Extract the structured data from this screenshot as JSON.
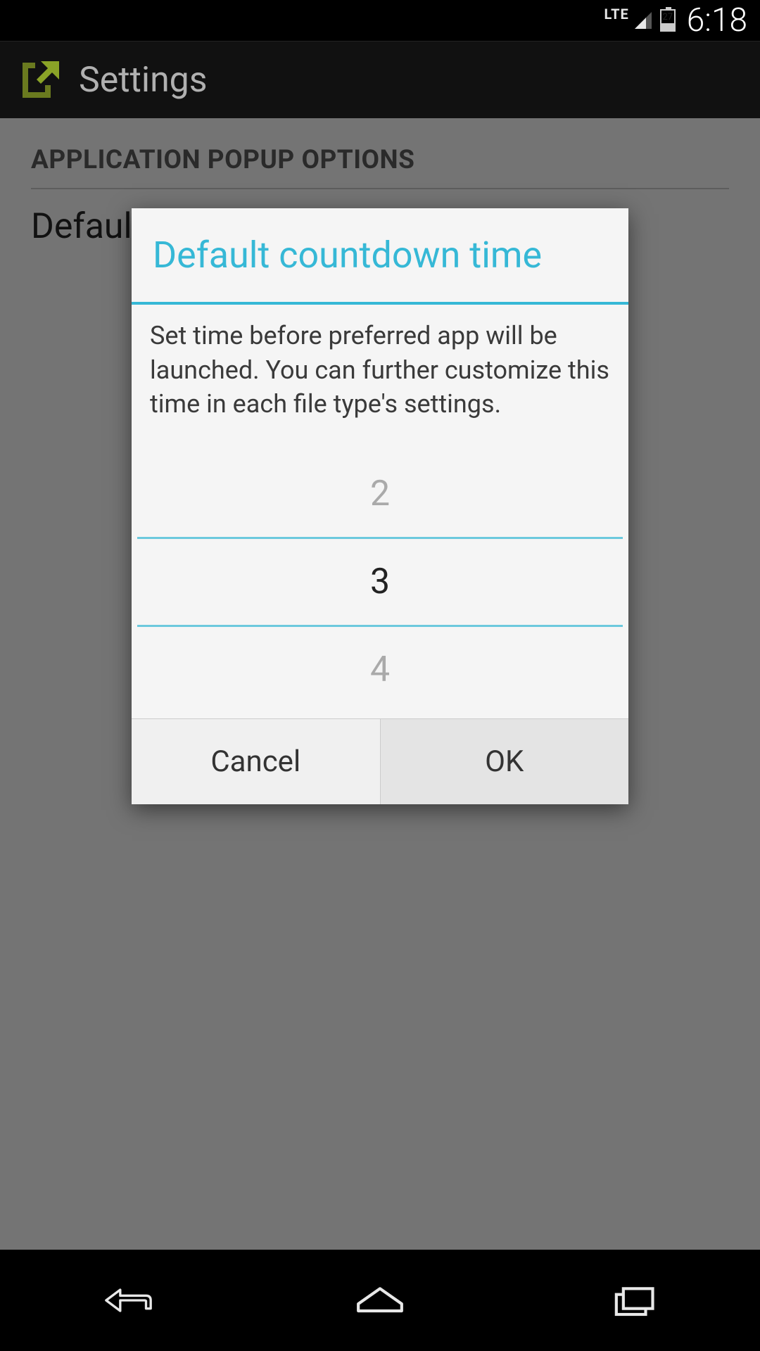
{
  "status": {
    "network": "LTE",
    "battery_level": "27",
    "time": "6:18"
  },
  "action_bar": {
    "title": "Settings"
  },
  "background": {
    "section_header": "APPLICATION POPUP OPTIONS",
    "peek_item": "Default countdown time"
  },
  "dialog": {
    "title": "Default countdown time",
    "message": "Set time before preferred app will be launched. You can further customize this time in each file type's settings.",
    "picker": {
      "prev": "2",
      "selected": "3",
      "next": "4"
    },
    "cancel": "Cancel",
    "ok": "OK"
  },
  "colors": {
    "accent": "#36b8d6",
    "app_icon": "#6a7a1f"
  }
}
